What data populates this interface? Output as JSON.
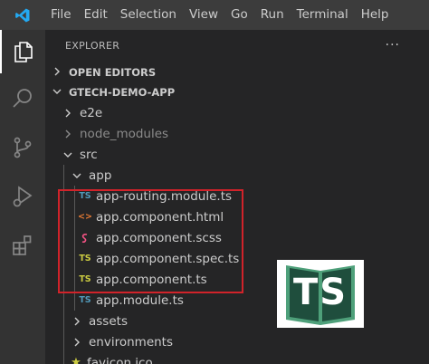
{
  "menu": {
    "items": [
      "File",
      "Edit",
      "Selection",
      "View",
      "Go",
      "Run",
      "Terminal",
      "Help"
    ]
  },
  "activity_bar": {
    "icons": [
      "explorer-icon",
      "search-icon",
      "source-control-icon",
      "run-debug-icon",
      "extensions-icon"
    ]
  },
  "explorer": {
    "title": "EXPLORER",
    "more": "···",
    "open_editors": "OPEN EDITORS",
    "project": "GTECH-DEMO-APP",
    "tree": {
      "e2e": "e2e",
      "node_modules": "node_modules",
      "src": "src",
      "app": "app",
      "files": [
        {
          "name": "app-routing.module.ts",
          "icon": "TS",
          "kind": "ts"
        },
        {
          "name": "app.component.html",
          "icon": "<>",
          "kind": "html"
        },
        {
          "name": "app.component.scss",
          "icon": "scss",
          "kind": "scss"
        },
        {
          "name": "app.component.spec.ts",
          "icon": "TS",
          "kind": "spec"
        },
        {
          "name": "app.component.ts",
          "icon": "TS",
          "kind": "spec"
        },
        {
          "name": "app.module.ts",
          "icon": "TS",
          "kind": "ts"
        }
      ],
      "assets": "assets",
      "environments": "environments",
      "favicon": "favicon.ico"
    }
  },
  "logo": {
    "text": "TS",
    "colors": {
      "dark": "#1f4e3d",
      "light": "#4ea07a",
      "bg": "#ffffff"
    }
  },
  "colors": {
    "highlight": "#d1232a",
    "ts_icon": "#519aba",
    "spec_icon": "#cbcb41",
    "html_icon": "#e37933",
    "scss_icon": "#f55385"
  }
}
